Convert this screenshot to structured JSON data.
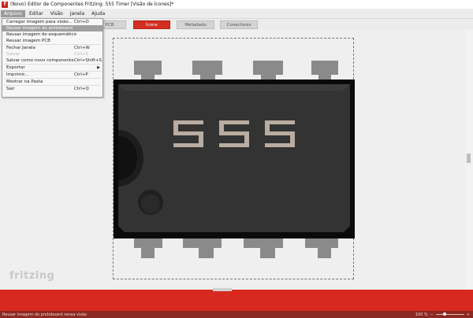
{
  "window": {
    "title": "(Novo) Editor de Componentes Fritzing: 555 Timer [Visão de Ícones]*",
    "app_icon": "f"
  },
  "menubar": {
    "items": [
      "Arquivo",
      "Editar",
      "Visão",
      "Janela",
      "Ajuda"
    ],
    "active": "Arquivo"
  },
  "tabs": {
    "items": [
      {
        "label": "PCB"
      },
      {
        "label": "Ícone"
      },
      {
        "label": "Metadado"
      },
      {
        "label": "Conectores"
      }
    ],
    "active": "Ícone"
  },
  "file_menu": {
    "items": [
      {
        "label": "Carregar imagem para visão...",
        "shortcut": "Ctrl+O"
      },
      {
        "label": "Reusar imagem do protoboard",
        "shortcut": "",
        "highlighted": true
      },
      {
        "label": "Reusar imagem do esquemático",
        "shortcut": ""
      },
      {
        "label": "Reusar imagem PCB",
        "shortcut": ""
      },
      {
        "label": "Fechar Janela",
        "shortcut": "Ctrl+W"
      },
      {
        "label": "Salvar",
        "shortcut": "Ctrl+S",
        "disabled": true
      },
      {
        "label": "Salvar como novo componente",
        "shortcut": "Ctrl+Shift+S"
      },
      {
        "label": "Exportar",
        "shortcut": "",
        "submenu": true
      },
      {
        "label": "Imprimir...",
        "shortcut": "Ctrl+P"
      },
      {
        "label": "Mostrar na Pasta",
        "shortcut": ""
      },
      {
        "label": "Sair",
        "shortcut": "Ctrl+Q"
      }
    ]
  },
  "chip": {
    "label": "555",
    "body_color": "#333333",
    "pin_color": "#8a8a8a",
    "label_color": "#b9aca0"
  },
  "logo": "fritzing",
  "status": {
    "message": "Reusar imagem do protoboard nessa visão",
    "zoom": "100 %"
  },
  "colors": {
    "accent_red": "#d7291f",
    "status_bar": "#8a2a22"
  }
}
